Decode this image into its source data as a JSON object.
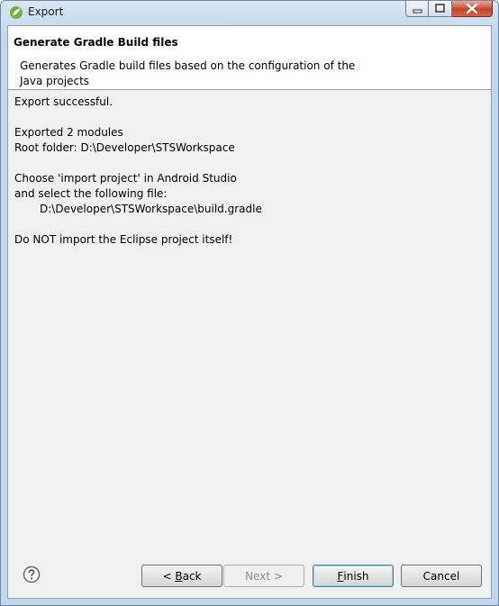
{
  "window": {
    "title": "Export",
    "app_icon": "eclipse-icon"
  },
  "header": {
    "title": "Generate Gradle Build files",
    "description": "Generates Gradle build files based on the configuration of the\nJava projects"
  },
  "content": {
    "lines": [
      "Export successful.",
      "",
      "Exported 2 modules",
      "Root folder: D:\\Developer\\STSWorkspace",
      "",
      "Choose 'import project' in Android Studio",
      "and select the following file:",
      "D:\\Developer\\STSWorkspace\\build.gradle",
      "",
      "Do NOT import the Eclipse project itself!"
    ]
  },
  "buttons": {
    "back": {
      "prefix": "< ",
      "mnemonic": "B",
      "rest": "ack"
    },
    "next": {
      "label": "Next >"
    },
    "finish": {
      "mnemonic": "F",
      "rest": "inish"
    },
    "cancel": {
      "label": "Cancel"
    }
  },
  "icons": {
    "help": "help-icon",
    "minimize": "minimize-icon",
    "maximize": "maximize-icon",
    "close": "close-icon"
  },
  "colors": {
    "title_bar": "#c2d6ec",
    "dialog_bg": "#f0f0f0",
    "close_button": "#c8452f",
    "default_button_border": "#3c7fb1"
  }
}
